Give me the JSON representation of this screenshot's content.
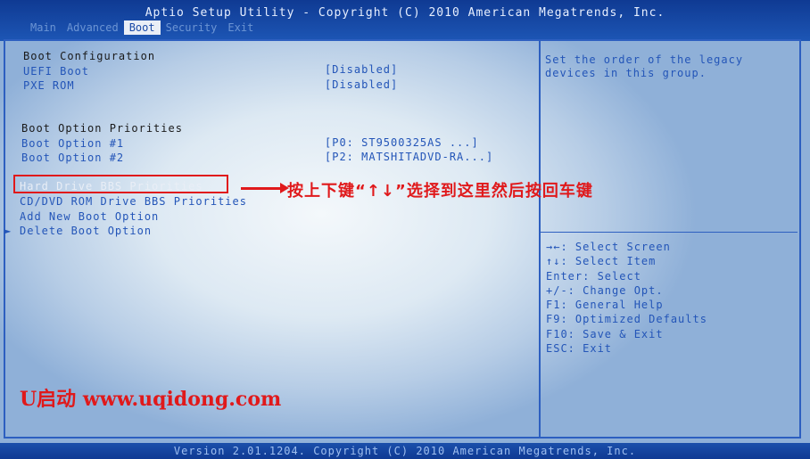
{
  "title": "Aptio Setup Utility - Copyright (C) 2010 American Megatrends, Inc.",
  "tabs": [
    "Main",
    "Advanced",
    "Boot",
    "Security",
    "Exit"
  ],
  "active_tab": "Boot",
  "boot_config": {
    "header": "Boot Configuration",
    "uefi_boot": {
      "label": "UEFI Boot",
      "value": "[Disabled]"
    },
    "pxe_rom": {
      "label": "PXE ROM",
      "value": "[Disabled]"
    }
  },
  "priorities": {
    "header": "Boot Option Priorities",
    "option1": {
      "label": "Boot Option #1",
      "value": "[P0: ST9500325AS    ...]"
    },
    "option2": {
      "label": "Boot Option #2",
      "value": "[P2: MATSHITADVD-RA...]"
    }
  },
  "menu": {
    "hdd_bbs": "Hard Drive BBS Priorities",
    "cd_bbs": "CD/DVD ROM Drive BBS Priorities",
    "add_option": "Add New Boot Option",
    "delete_option": "Delete Boot Option",
    "submenu_marker": "►"
  },
  "annotation": "按上下键“↑↓”选择到这里然后按回车键",
  "help_text": "Set the order of the legacy devices in this group.",
  "keys": [
    "→←: Select Screen",
    "↑↓: Select Item",
    "Enter: Select",
    "+/-: Change Opt.",
    "F1: General Help",
    "F9: Optimized Defaults",
    "F10: Save & Exit",
    "ESC: Exit"
  ],
  "watermark": "U启动 www.uqidong.com",
  "footer": "Version 2.01.1204. Copyright (C) 2010 American Megatrends, Inc.",
  "colors": {
    "accent_red": "#e0191b",
    "bios_blue": "#1b4aa7"
  }
}
